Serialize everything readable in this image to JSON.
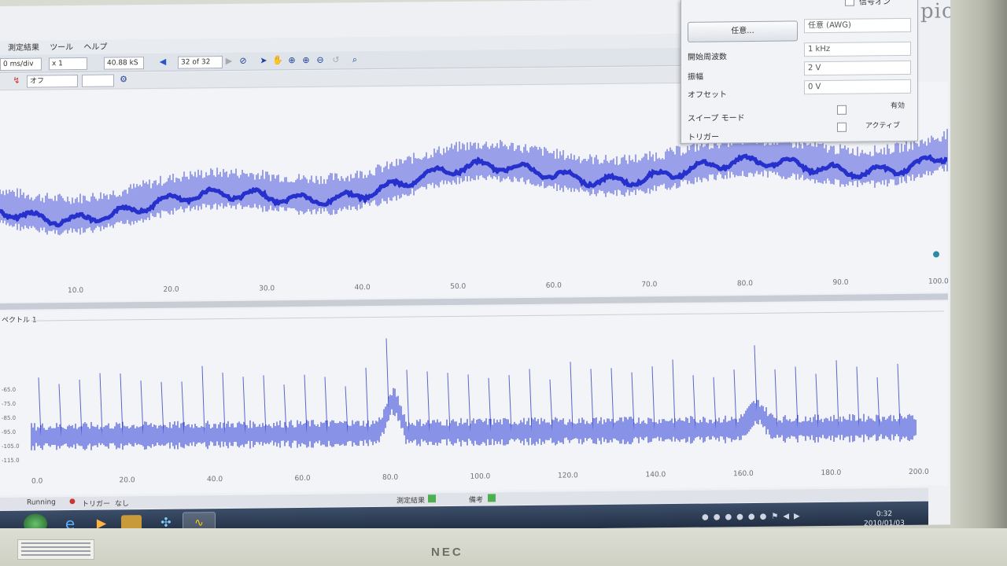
{
  "menu": [
    "測定結果",
    "ツール",
    "ヘルプ"
  ],
  "toolbar": {
    "timebase": "0 ms/div",
    "multiplier": "x 1",
    "samples": "40.88 kS",
    "capture_count": "32 of 32",
    "trigger_mode": "オフ"
  },
  "siggen": {
    "enabled_label": "信号オン",
    "button_label": "任意...",
    "wave_type": "任意 (AWG)",
    "rows": [
      {
        "label": "開始周波数",
        "value": "1 kHz"
      },
      {
        "label": "振幅",
        "value": "2 V"
      },
      {
        "label": "オフセット",
        "value": "0 V"
      }
    ],
    "sweep_label": "スイープ モード",
    "sweep_state": "有効",
    "trigger_label": "トリガー",
    "trigger_state": "アクティブ"
  },
  "brand": "pico",
  "scope_view": {
    "x_ticks": [
      "10.0",
      "20.0",
      "30.0",
      "40.0",
      "50.0",
      "60.0",
      "70.0",
      "80.0",
      "90.0",
      "100.0"
    ]
  },
  "spectrum_view": {
    "title": "ペクトル 1",
    "x_ticks": [
      "0.0",
      "20.0",
      "40.0",
      "60.0",
      "80.0",
      "100.0",
      "120.0",
      "140.0",
      "160.0",
      "180.0",
      "200.0"
    ],
    "y_ticks": [
      "-65.0",
      "-75.0",
      "-85.0",
      "-95.0",
      "-105.0",
      "-115.0"
    ]
  },
  "statusbar": {
    "left": "Running",
    "trigger": "トリガー",
    "trigger_value": "なし",
    "measure": "測定結果",
    "notes": "備考"
  },
  "clock": {
    "time": "0:32",
    "date": "2010/01/03"
  },
  "monitor_brand": "NEC"
}
